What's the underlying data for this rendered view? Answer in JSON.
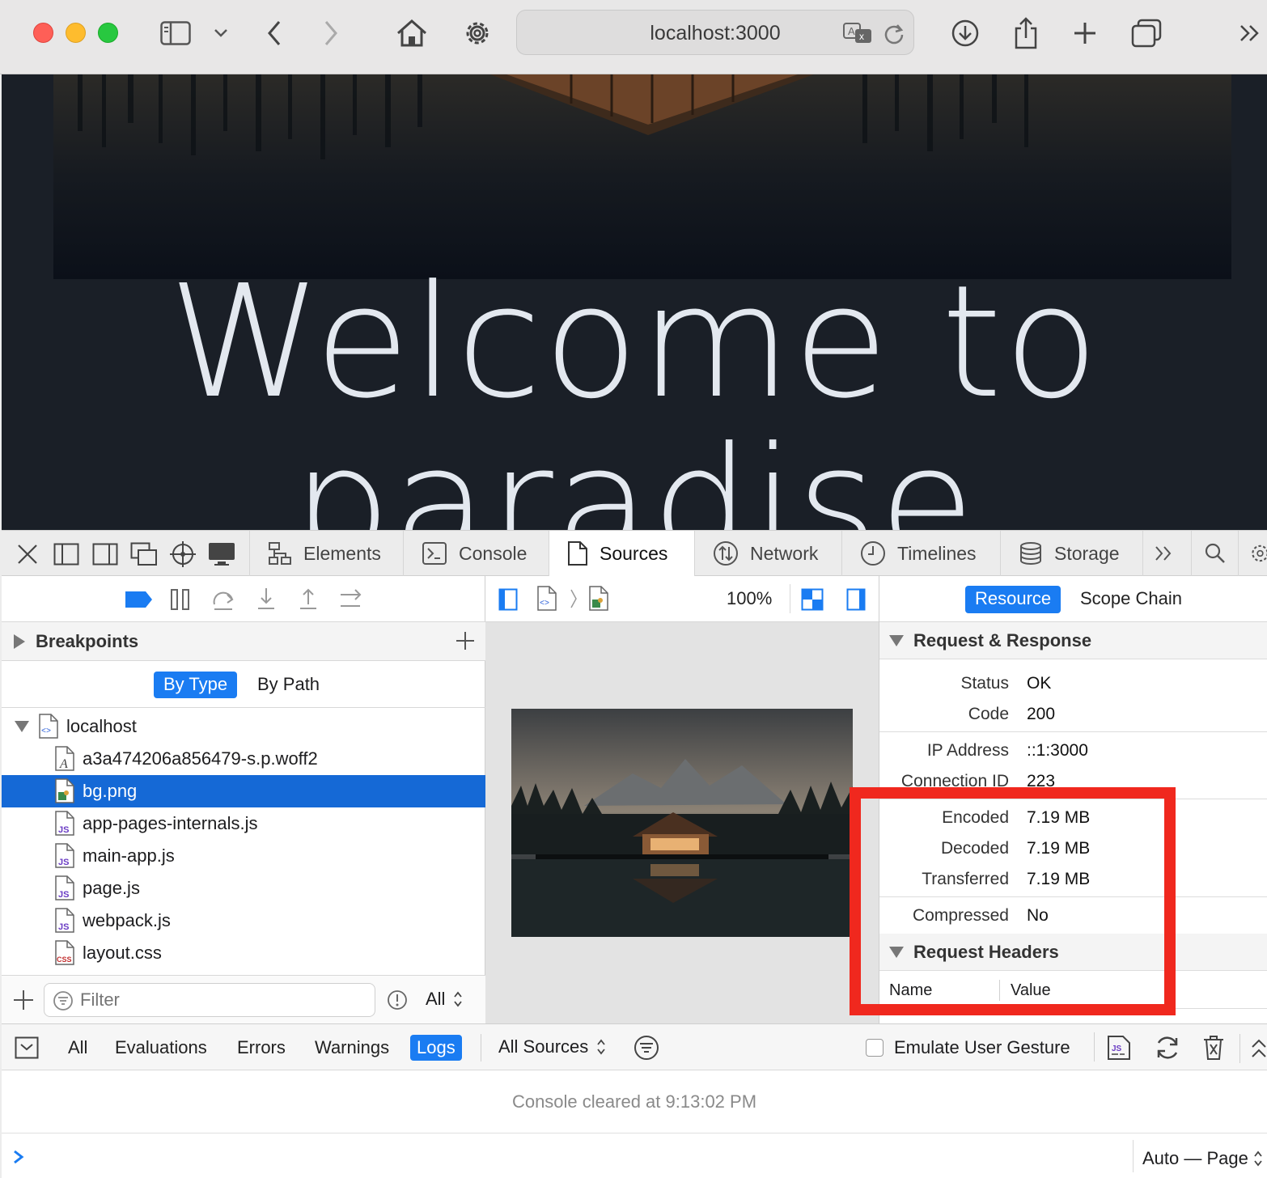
{
  "browser": {
    "url": "localhost:3000",
    "toolbar_icons": [
      "sidebar-icon",
      "chevron-down-icon",
      "back-icon",
      "forward-icon",
      "home-icon",
      "gear-icon",
      "translate-icon",
      "reload-icon",
      "download-icon",
      "share-icon",
      "new-tab-icon",
      "tab-overview-icon",
      "more-icon"
    ]
  },
  "webpage": {
    "hero_title": "Welcome to paradise"
  },
  "devtools": {
    "tabs": [
      {
        "label": "Elements"
      },
      {
        "label": "Console"
      },
      {
        "label": "Sources"
      },
      {
        "label": "Network"
      },
      {
        "label": "Timelines"
      },
      {
        "label": "Storage"
      }
    ],
    "active_tab": "Sources",
    "navigator": {
      "breakpoints_label": "Breakpoints",
      "toggle_by_type": "By Type",
      "toggle_by_path": "By Path",
      "root": "localhost",
      "files": [
        {
          "name": "a3a474206a856479-s.p.woff2",
          "kind": "font"
        },
        {
          "name": "bg.png",
          "kind": "image",
          "selected": true
        },
        {
          "name": "app-pages-internals.js",
          "kind": "js"
        },
        {
          "name": "main-app.js",
          "kind": "js"
        },
        {
          "name": "page.js",
          "kind": "js"
        },
        {
          "name": "webpack.js",
          "kind": "js"
        },
        {
          "name": "layout.css",
          "kind": "css"
        }
      ],
      "filter_placeholder": "Filter",
      "scope_select": "All"
    },
    "preview": {
      "zoom": "100%"
    },
    "sidebar": {
      "tab_resource": "Resource",
      "tab_scope_chain": "Scope Chain",
      "section_request_response": "Request & Response",
      "status_label": "Status",
      "status_value": "OK",
      "code_label": "Code",
      "code_value": "200",
      "ip_label": "IP Address",
      "ip_value": "::1:3000",
      "conn_label": "Connection ID",
      "conn_value": "223",
      "encoded_label": "Encoded",
      "encoded_value": "7.19 MB",
      "decoded_label": "Decoded",
      "decoded_value": "7.19 MB",
      "transferred_label": "Transferred",
      "transferred_value": "7.19 MB",
      "compressed_label": "Compressed",
      "compressed_value": "No",
      "section_request_headers": "Request Headers",
      "col_name": "Name",
      "col_value": "Value"
    },
    "console": {
      "filters": [
        "All",
        "Evaluations",
        "Errors",
        "Warnings",
        "Logs"
      ],
      "active_filter": "Logs",
      "sources_select": "All Sources",
      "emulate_label": "Emulate User Gesture",
      "cleared_message": "Console cleared at 9:13:02 PM",
      "execution_context": "Auto — Page"
    },
    "colors": {
      "accent": "#1a7cf2",
      "selection": "#1569d6",
      "highlight_box": "#f0281e"
    }
  }
}
